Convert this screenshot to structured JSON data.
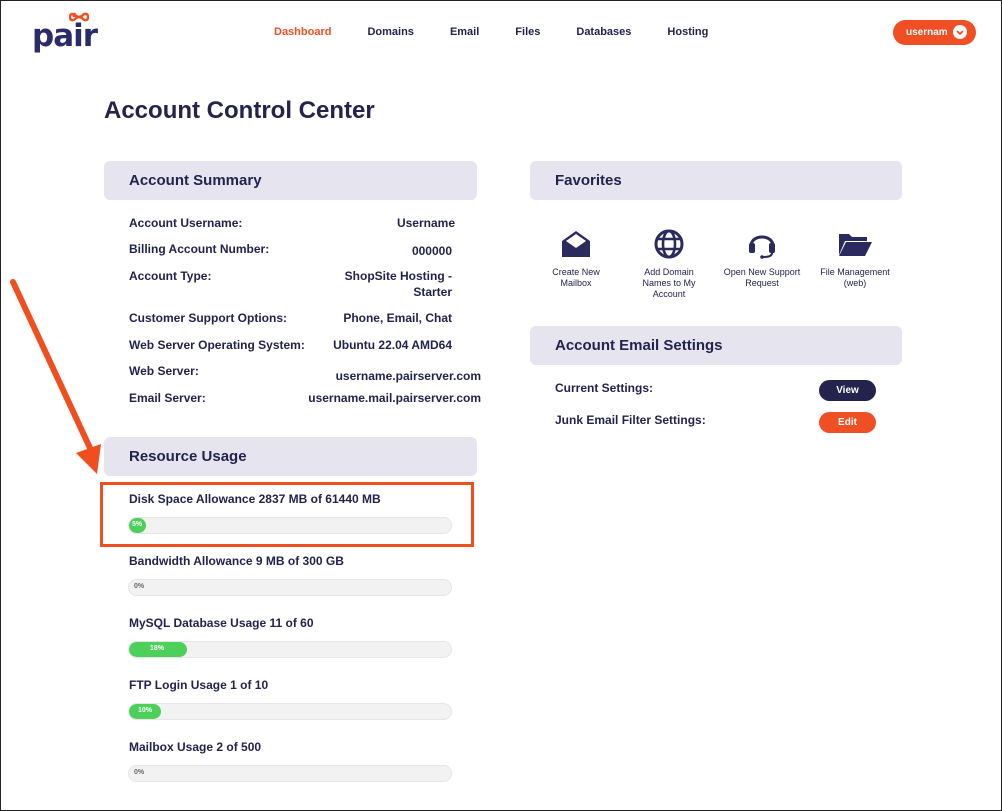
{
  "brand": {
    "logo_text": "pair"
  },
  "nav": [
    {
      "label": "Dashboard",
      "active": true
    },
    {
      "label": "Domains"
    },
    {
      "label": "Email"
    },
    {
      "label": "Files"
    },
    {
      "label": "Databases"
    },
    {
      "label": "Hosting"
    }
  ],
  "user_menu": {
    "label": "usernam",
    "icon": "chevron-down-icon"
  },
  "page": {
    "title": "Account Control Center"
  },
  "account_summary": {
    "heading": "Account Summary",
    "rows": [
      {
        "label": "Account Username:",
        "value": "Username"
      },
      {
        "label": "Billing Account Number:",
        "value": "000000"
      },
      {
        "label": "Account Type:",
        "value": "ShopSite Hosting -",
        "value2": "Starter"
      },
      {
        "label": "Customer Support Options:",
        "value": "Phone, Email, Chat"
      },
      {
        "label": "Web Server Operating System:",
        "value": "Ubuntu 22.04 AMD64"
      },
      {
        "label": "Web Server:",
        "value": "username.pairserver.com"
      },
      {
        "label": "Email Server:",
        "value": "username.mail.pairserver.com"
      }
    ]
  },
  "resource_usage": {
    "heading": "Resource Usage",
    "items": [
      {
        "label": "Disk Space Allowance 2837 MB of 61440 MB",
        "percent": 5,
        "percent_text": "5%"
      },
      {
        "label": "Bandwidth Allowance 9 MB of 300 GB",
        "percent": 0,
        "percent_text": "0%"
      },
      {
        "label": "MySQL Database Usage 11 of 60",
        "percent": 18,
        "percent_text": "18%"
      },
      {
        "label": "FTP Login Usage 1 of 10",
        "percent": 10,
        "percent_text": "10%"
      },
      {
        "label": "Mailbox Usage 2 of 500",
        "percent": 0,
        "percent_text": "0%"
      }
    ]
  },
  "favorites": {
    "heading": "Favorites",
    "items": [
      {
        "label_1": "Create New",
        "label_2": "Mailbox",
        "label_3": "",
        "icon": "open-envelope-icon"
      },
      {
        "label_1": "Add Domain",
        "label_2": "Names to My",
        "label_3": "Account",
        "icon": "globe-icon"
      },
      {
        "label_1": "Open New Support",
        "label_2": "Request",
        "label_3": "",
        "icon": "headset-icon"
      },
      {
        "label_1": "File Management",
        "label_2": "(web)",
        "label_3": "",
        "icon": "folder-icon"
      }
    ]
  },
  "email_settings": {
    "heading": "Account Email Settings",
    "rows": [
      {
        "label": "Current Settings:",
        "button": "View"
      },
      {
        "label": "Junk Email Filter Settings:",
        "button": "Edit"
      }
    ]
  },
  "colors": {
    "accent": "#f04e23",
    "navy": "#23234d",
    "panel": "#e6e5ef",
    "progress": "#4cd05a"
  }
}
